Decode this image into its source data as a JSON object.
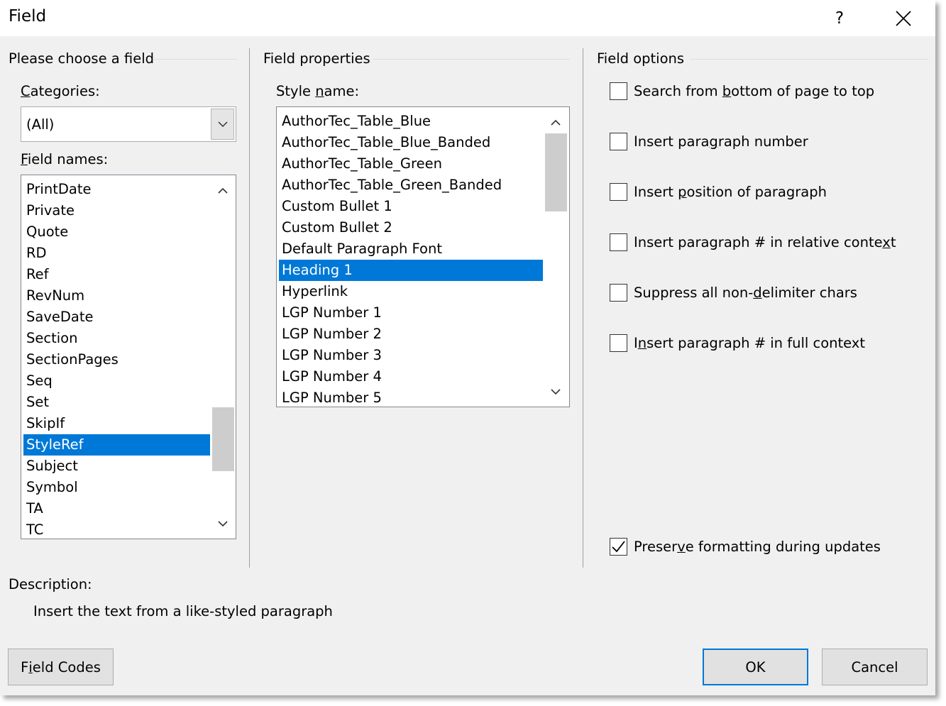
{
  "window": {
    "title": "Field",
    "help_label": "?"
  },
  "left_group": {
    "title": "Please choose a field",
    "categories_label_u": "C",
    "categories_label_rest": "ategories:",
    "categories_value": "(All)",
    "field_names_label_u": "F",
    "field_names_label_rest": "ield names:",
    "field_names": [
      "PrintDate",
      "Private",
      "Quote",
      "RD",
      "Ref",
      "RevNum",
      "SaveDate",
      "Section",
      "SectionPages",
      "Seq",
      "Set",
      "SkipIf",
      "StyleRef",
      "Subject",
      "Symbol",
      "TA",
      "TC"
    ],
    "selected_field": "StyleRef"
  },
  "middle_group": {
    "title": "Field properties",
    "style_name_label_pre": "Style ",
    "style_name_label_u": "n",
    "style_name_label_post": "ame:",
    "styles": [
      "AuthorTec_Table_Blue",
      "AuthorTec_Table_Blue_Banded",
      "AuthorTec_Table_Green",
      "AuthorTec_Table_Green_Banded",
      "Custom Bullet 1",
      "Custom Bullet 2",
      "Default Paragraph Font",
      "Heading 1",
      "Hyperlink",
      "LGP Number 1",
      "LGP Number 2",
      "LGP Number 3",
      "LGP Number 4",
      "LGP Number 5"
    ],
    "selected_style": "Heading 1"
  },
  "right_group": {
    "title": "Field options",
    "options": [
      {
        "pre": "Search from ",
        "u": "b",
        "post": "ottom of page to top",
        "checked": false
      },
      {
        "pre": "Insert para",
        "u": "g",
        "post": "raph number",
        "checked": false
      },
      {
        "pre": "Insert ",
        "u": "p",
        "post": "osition of paragraph",
        "checked": false
      },
      {
        "pre": "Insert paragraph # in relative conte",
        "u": "x",
        "post": "t",
        "checked": false
      },
      {
        "pre": "Suppress all non-",
        "u": "d",
        "post": "elimiter chars",
        "checked": false
      },
      {
        "pre": "I",
        "u": "n",
        "post": "sert paragraph # in full context",
        "checked": false
      }
    ],
    "preserve": {
      "pre": "Preser",
      "u": "v",
      "post": "e formatting during updates",
      "checked": true
    }
  },
  "description": {
    "label": "Description:",
    "text": "Insert the text from a like-styled paragraph"
  },
  "buttons": {
    "field_codes_pre": "F",
    "field_codes_u": "i",
    "field_codes_post": "eld Codes",
    "ok": "OK",
    "cancel": "Cancel"
  },
  "colors": {
    "selection": "#0078d7",
    "dialog_bg": "#f0f0f0"
  }
}
